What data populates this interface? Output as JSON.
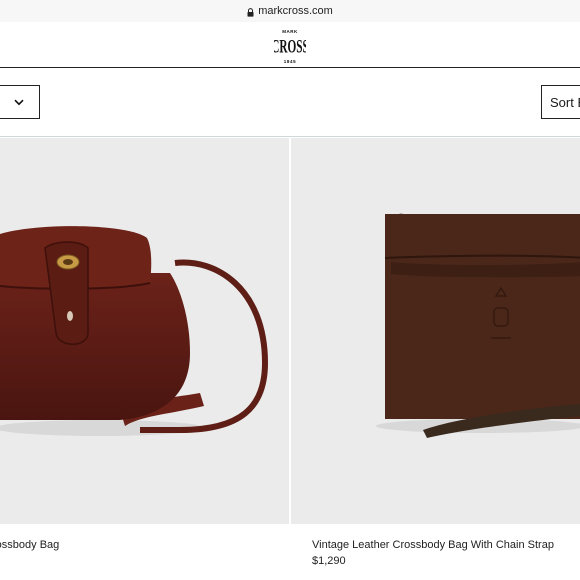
{
  "browser": {
    "url": "markcross.com"
  },
  "header": {
    "brand": "MARK CROSS",
    "brand_top": "MARK",
    "brand_main": "CROSS",
    "brand_year": "1845"
  },
  "filters": {
    "sort_label": "Sort By"
  },
  "products": [
    {
      "name": "rossbody Bag",
      "price": ""
    },
    {
      "name": "Vintage Leather Crossbody Bag With Chain Strap",
      "price": "$1,290"
    }
  ],
  "colors": {
    "page_bg": "#ffffff",
    "photo_bg": "#ebebeb",
    "leather_red": "#5e1e16",
    "leather_brown": "#4a2618",
    "border": "#222222"
  }
}
